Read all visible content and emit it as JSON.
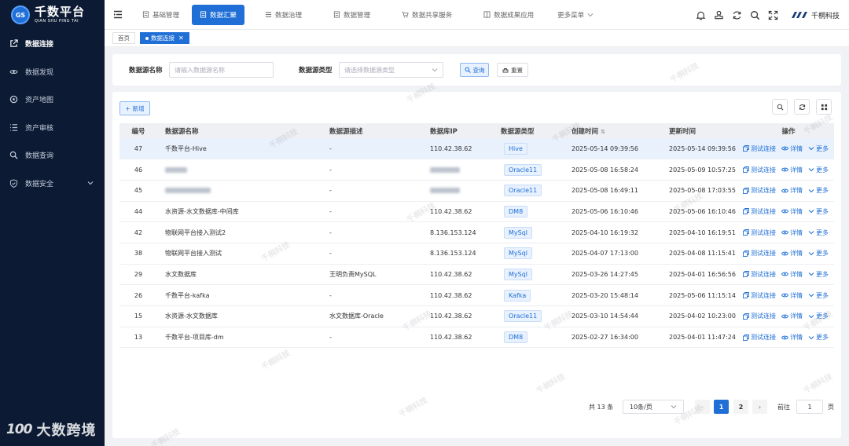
{
  "app": {
    "logo_badge": "GS",
    "logo_main": "千数平台",
    "logo_sub": "QIAN SHU PING TAI"
  },
  "sidebar": {
    "items": [
      {
        "label": "数据连接",
        "icon": "external-link-icon",
        "active": true
      },
      {
        "label": "数据发现",
        "icon": "eye-icon"
      },
      {
        "label": "资产地图",
        "icon": "target-icon"
      },
      {
        "label": "资产审核",
        "icon": "list-icon"
      },
      {
        "label": "数据查询",
        "icon": "search-icon"
      },
      {
        "label": "数据安全",
        "icon": "shield-icon",
        "expandable": true
      }
    ]
  },
  "topnav": {
    "items": [
      {
        "label": "基础管理",
        "icon": "document-icon"
      },
      {
        "label": "数据汇聚",
        "icon": "document-icon",
        "active": true
      },
      {
        "label": "数据治理",
        "icon": "list-icon"
      },
      {
        "label": "数据管理",
        "icon": "document-icon"
      },
      {
        "label": "数据共享服务",
        "icon": "cart-icon"
      },
      {
        "label": "数据成果应用",
        "icon": "layout-icon"
      },
      {
        "label": "更多菜单",
        "icon": "chevron-down-icon"
      }
    ]
  },
  "header": {
    "company": "千桐科技"
  },
  "tabs": [
    {
      "label": "首页"
    },
    {
      "label": "数据连接",
      "active": true
    }
  ],
  "search": {
    "name_label": "数据源名称",
    "name_placeholder": "请输入数据源名称",
    "type_label": "数据源类型",
    "type_placeholder": "请选择数据源类型",
    "query_button": "查询",
    "reset_button": "重置"
  },
  "toolbar": {
    "add_button": "新增"
  },
  "table": {
    "headers": {
      "id": "编号",
      "name": "数据源名称",
      "desc": "数据源描述",
      "ip": "数据库IP",
      "type": "数据源类型",
      "created": "创建时间",
      "updated": "更新时间",
      "ops": "操作"
    },
    "op_labels": {
      "test": "测试连接",
      "detail": "详情",
      "more": "更多"
    },
    "rows": [
      {
        "id": "47",
        "name": "千数平台-Hive",
        "desc": "-",
        "ip": "110.42.38.62",
        "type": "Hive",
        "created": "2025-05-14 09:39:56",
        "updated": "2025-05-14 09:39:56",
        "highlight": true
      },
      {
        "id": "46",
        "name": "",
        "desc": "-",
        "ip": "",
        "type": "Oracle11",
        "created": "2025-05-08 16:58:24",
        "updated": "2025-05-09 10:57:25",
        "blur_name": true,
        "blur_ip": true
      },
      {
        "id": "45",
        "name": "",
        "desc": "-",
        "ip": "",
        "type": "Oracle11",
        "created": "2025-05-08 16:49:11",
        "updated": "2025-05-08 17:03:55",
        "blur_name": true,
        "blur_ip": true
      },
      {
        "id": "44",
        "name": "水资源-水文数据库-中间库",
        "desc": "-",
        "ip": "110.42.38.62",
        "type": "DM8",
        "created": "2025-05-06 16:10:46",
        "updated": "2025-05-06 16:10:46"
      },
      {
        "id": "42",
        "name": "物联网平台接入测试2",
        "desc": "-",
        "ip": "8.136.153.124",
        "type": "MySql",
        "created": "2025-04-10 16:19:32",
        "updated": "2025-04-10 16:19:51"
      },
      {
        "id": "38",
        "name": "物联网平台接入测试",
        "desc": "-",
        "ip": "8.136.153.124",
        "type": "MySql",
        "created": "2025-04-07 17:13:00",
        "updated": "2025-04-08 11:15:41"
      },
      {
        "id": "29",
        "name": "水文数据库",
        "desc": "王明负责MySQL",
        "ip": "110.42.38.62",
        "type": "MySql",
        "created": "2025-03-26 14:27:45",
        "updated": "2025-04-01 16:56:56"
      },
      {
        "id": "26",
        "name": "千数平台-kafka",
        "desc": "-",
        "ip": "110.42.38.62",
        "type": "Kafka",
        "created": "2025-03-20 15:48:14",
        "updated": "2025-05-06 11:15:14"
      },
      {
        "id": "15",
        "name": "水资源-水文数据库",
        "desc": "水文数据库-Oracle",
        "ip": "110.42.38.62",
        "type": "Oracle11",
        "created": "2025-03-10 14:54:44",
        "updated": "2025-04-02 10:23:00"
      },
      {
        "id": "13",
        "name": "千数平台-项目库-dm",
        "desc": "-",
        "ip": "110.42.38.62",
        "type": "DM8",
        "created": "2025-02-27 16:34:00",
        "updated": "2025-04-01 11:47:24"
      }
    ]
  },
  "pagination": {
    "total": "共 13 条",
    "page_size": "10条/页",
    "pages": [
      "1",
      "2"
    ],
    "current": "1",
    "goto_label": "前往",
    "goto_value": "1",
    "page_suffix": "页"
  },
  "watermark_text": "千桐科技",
  "corner_brand": {
    "logo": "100",
    "text": "大数跨境"
  },
  "colors": {
    "sidebar_bg": "#0c1a33",
    "primary": "#1f6fd6"
  }
}
